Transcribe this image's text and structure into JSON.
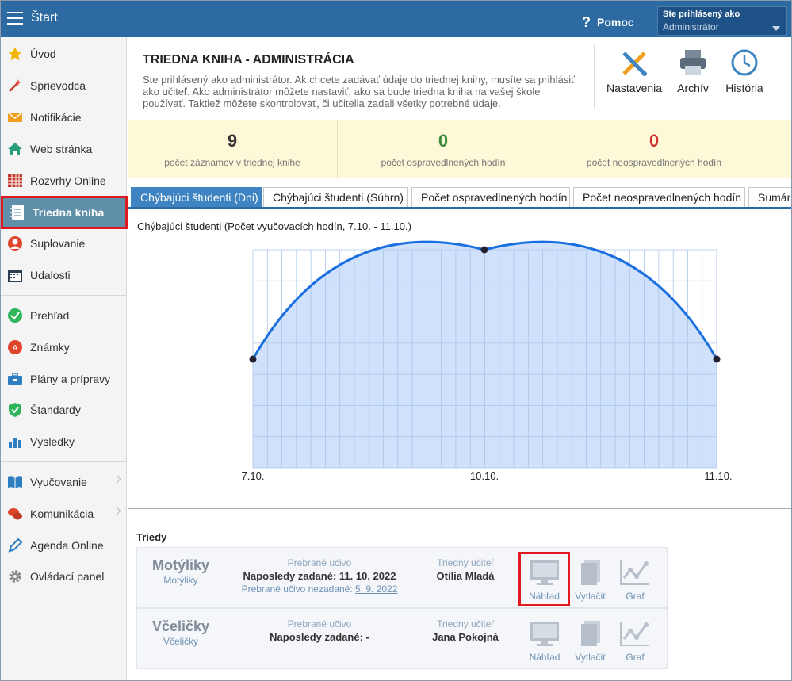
{
  "topbar": {
    "title": "Štart",
    "help": "Pomoc",
    "user_label": "Ste prihlásený ako",
    "user_value": "Administrátor"
  },
  "sidebar": {
    "items": [
      {
        "label": "Úvod",
        "icon": "star-icon"
      },
      {
        "label": "Sprievodca",
        "icon": "magic-wand-icon"
      },
      {
        "label": "Notifikácie",
        "icon": "envelope-icon"
      },
      {
        "label": "Web stránka",
        "icon": "house-icon"
      },
      {
        "label": "Rozvrhy Online",
        "icon": "timetable-icon"
      },
      {
        "label": "Triedna kniha",
        "icon": "notebook-icon"
      },
      {
        "label": "Suplovanie",
        "icon": "person-icon"
      },
      {
        "label": "Udalosti",
        "icon": "calendar-icon"
      },
      {
        "label": "Prehľad",
        "icon": "check-circle-icon"
      },
      {
        "label": "Známky",
        "icon": "grade-icon"
      },
      {
        "label": "Plány a prípravy",
        "icon": "briefcase-icon"
      },
      {
        "label": "Štandardy",
        "icon": "shield-check-icon"
      },
      {
        "label": "Výsledky",
        "icon": "bar-chart-icon"
      },
      {
        "label": "Vyučovanie",
        "icon": "open-book-icon"
      },
      {
        "label": "Komunikácia",
        "icon": "chat-icon"
      },
      {
        "label": "Agenda Online",
        "icon": "pen-icon"
      },
      {
        "label": "Ovládací panel",
        "icon": "gear-icon"
      }
    ]
  },
  "header": {
    "title": "TRIEDNA KNIHA - ADMINISTRÁCIA",
    "description": "Ste prihlásený ako administrátor. Ak chcete zadávať údaje do triednej knihy, musíte sa prihlásiť ako učiteľ. Ako administrátor môžete nastaviť, ako sa bude triedna kniha na vašej škole používať. Taktiež môžete skontrolovať, či učitelia zadali všetky potrebné údaje.",
    "buttons": {
      "settings": "Nastavenia",
      "archive": "Archív",
      "history": "História"
    }
  },
  "stats": [
    {
      "value": "9",
      "label": "počet záznamov v triednej knihe",
      "color": "#333333"
    },
    {
      "value": "0",
      "label": "počet ospravedlnených hodín",
      "color": "#3c8a3c"
    },
    {
      "value": "0",
      "label": "počet neospravedlnených hodín",
      "color": "#d03030"
    }
  ],
  "tabs": [
    "Chýbajúci študenti (Dni)",
    "Chýbajúci študenti (Súhrn)",
    "Počet ospravedlnených hodín",
    "Počet neospravedlnených hodín",
    "Sumár"
  ],
  "chart": {
    "title": "Chýbajúci študenti (Počet vyučovacích hodín, 7.10. - 11.10.)"
  },
  "chart_data": {
    "type": "area",
    "categories": [
      "7.10.",
      "10.10.",
      "11.10."
    ]
  },
  "classes": {
    "title": "Triedy",
    "rows": [
      {
        "name": "Motýliky",
        "sub": "Motýliky",
        "taken_label": "Prebrané učivo",
        "last_entered": "Naposledy zadané: 11. 10. 2022",
        "not_entered_label": "Prebrané učivo nezadané:",
        "not_entered_date": "5. 9. 2022",
        "teacher_label": "Triedny učiteľ",
        "teacher": "Otília Mladá",
        "preview": "Náhľad",
        "print": "Vytlačiť",
        "graph": "Graf"
      },
      {
        "name": "Včeličky",
        "sub": "Včeličky",
        "taken_label": "Prebrané učivo",
        "last_entered": "Naposledy zadané: -",
        "teacher_label": "Triedny učiteľ",
        "teacher": "Jana Pokojná",
        "preview": "Náhľad",
        "print": "Vytlačiť",
        "graph": "Graf"
      }
    ]
  }
}
